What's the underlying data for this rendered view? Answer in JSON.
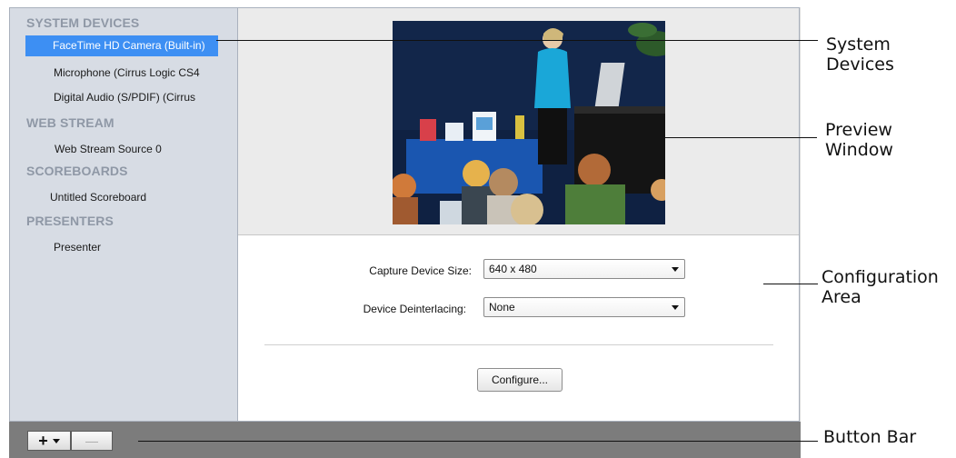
{
  "sidebar": {
    "sections": [
      {
        "title": "SYSTEM DEVICES",
        "items": [
          "FaceTime HD Camera (Built-in)",
          "Microphone (Cirrus Logic CS4",
          "Digital Audio (S/PDIF) (Cirrus"
        ]
      },
      {
        "title": "WEB STREAM",
        "items": [
          "Web Stream Source 0"
        ]
      },
      {
        "title": "SCOREBOARDS",
        "items": [
          "Untitled Scoreboard"
        ]
      },
      {
        "title": "PRESENTERS",
        "items": [
          "Presenter"
        ]
      }
    ],
    "selected_item": "FaceTime HD Camera (Built-in)"
  },
  "config": {
    "capture_size_label": "Capture Device Size:",
    "capture_size_value": "640 x 480",
    "deinterlacing_label": "Device Deinterlacing:",
    "deinterlacing_value": "None",
    "configure_button": "Configure..."
  },
  "button_bar": {
    "add_label": "+",
    "remove_label": "—"
  },
  "callouts": {
    "system_devices": [
      "System",
      "Devices"
    ],
    "preview_window": [
      "Preview",
      "Window"
    ],
    "configuration_area": [
      "Configuration",
      "Area"
    ],
    "button_bar": [
      "Button Bar"
    ]
  },
  "colors": {
    "selection": "#3d8ff3",
    "section_header": "#8f98a6",
    "button_bar": "#7c7c7c"
  }
}
